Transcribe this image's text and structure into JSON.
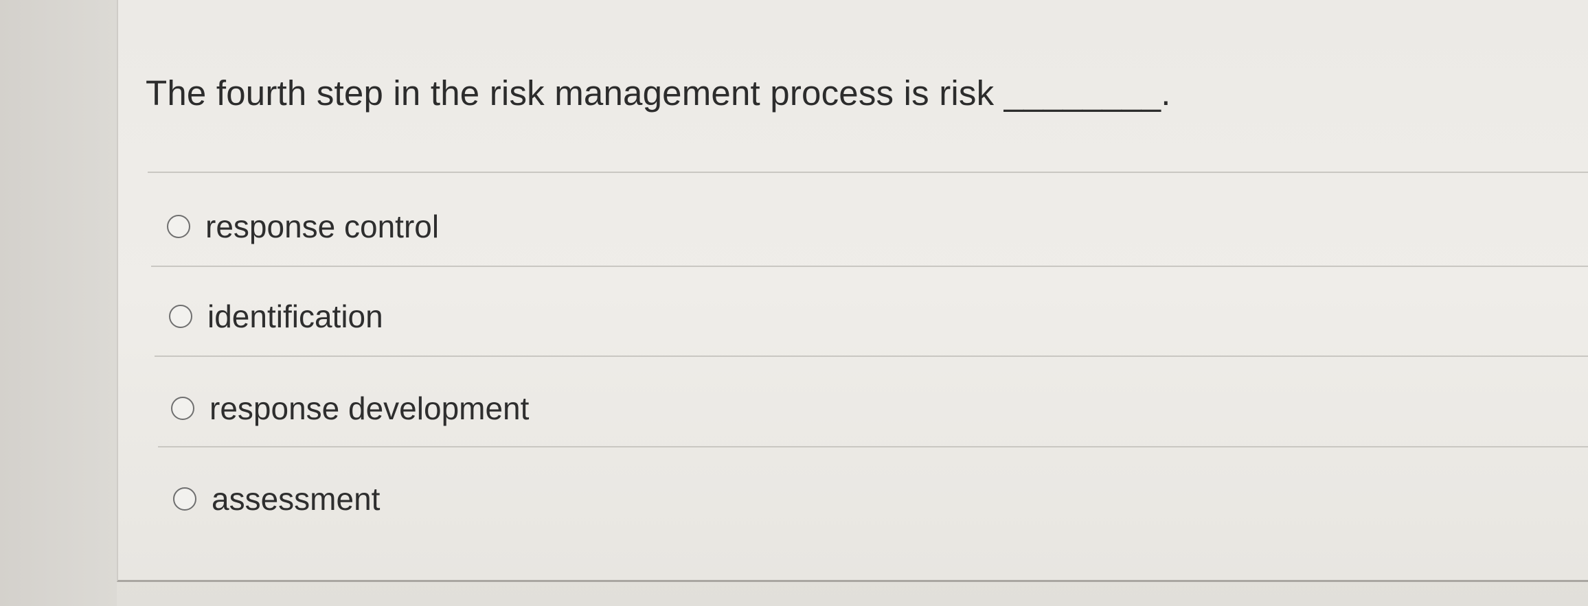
{
  "question": {
    "text": "The fourth step in the risk management process is risk ________."
  },
  "options": [
    {
      "label": "response control"
    },
    {
      "label": "identification"
    },
    {
      "label": "response development"
    },
    {
      "label": "assessment"
    }
  ],
  "colors": {
    "page_background": "#e9e7e3",
    "text": "#2c2c2c",
    "divider": "#c9c7c2",
    "radio_border": "#6f6f6f"
  }
}
